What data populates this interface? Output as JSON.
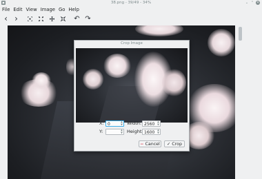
{
  "window": {
    "title": "38.png - 39/49 - 34%",
    "controls": {
      "minimize": "⌄",
      "maximize": "⌃",
      "close": "✕"
    }
  },
  "menubar": {
    "items": [
      "File",
      "Edit",
      "View",
      "Image",
      "Go",
      "Help"
    ]
  },
  "toolbar": {
    "buttons": [
      {
        "name": "previous",
        "icon": "chevron-left-icon",
        "glyph": "‹"
      },
      {
        "name": "next",
        "icon": "chevron-right-icon",
        "glyph": "›"
      },
      {
        "name": "zoom-fit",
        "icon": "zoom-fit-icon"
      },
      {
        "name": "zoom-in",
        "icon": "zoom-in-icon"
      },
      {
        "name": "zoom-out",
        "icon": "zoom-out-icon"
      },
      {
        "name": "zoom-original",
        "icon": "zoom-original-icon"
      },
      {
        "name": "rotate-left",
        "icon": "rotate-left-icon",
        "glyph": "↶"
      },
      {
        "name": "rotate-right",
        "icon": "rotate-right-icon",
        "glyph": "↷"
      }
    ]
  },
  "dialog": {
    "title": "Crop Image",
    "x_label": "X:",
    "x_value": "0",
    "y_label": "Y:",
    "y_value": "",
    "width_label": "Width:",
    "width_value": "2560",
    "height_label": "Height:",
    "height_value": "1600",
    "cancel_label": "Cancel",
    "crop_label": "Crop"
  },
  "colors": {
    "accent": "#3daee9",
    "window_bg": "#eff0f1",
    "cancel_icon": "#da4453"
  }
}
